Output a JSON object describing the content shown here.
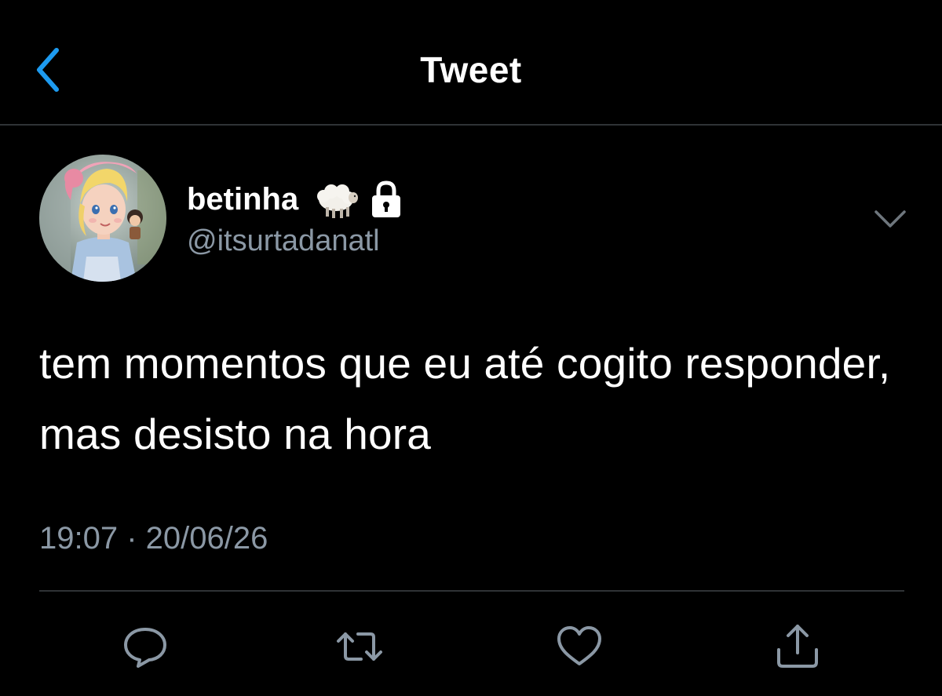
{
  "header": {
    "title": "Tweet",
    "back_icon": "chevron-left-icon"
  },
  "author": {
    "display_name": "betinha",
    "emoji": "sheep-icon",
    "protected_icon": "lock-icon",
    "handle": "@itsurtadanatl"
  },
  "tweet": {
    "text": "tem momentos que eu até cogito responder, mas desisto na hora",
    "timestamp": "19:07 · 20/06/26"
  },
  "actions": [
    {
      "name": "reply",
      "icon": "comment-icon"
    },
    {
      "name": "retweet",
      "icon": "retweet-icon"
    },
    {
      "name": "like",
      "icon": "heart-icon"
    },
    {
      "name": "share",
      "icon": "share-icon"
    }
  ],
  "colors": {
    "background": "#000000",
    "accent": "#1d9bf0",
    "secondary_text": "#8b98a5",
    "divider": "#2f3336"
  }
}
